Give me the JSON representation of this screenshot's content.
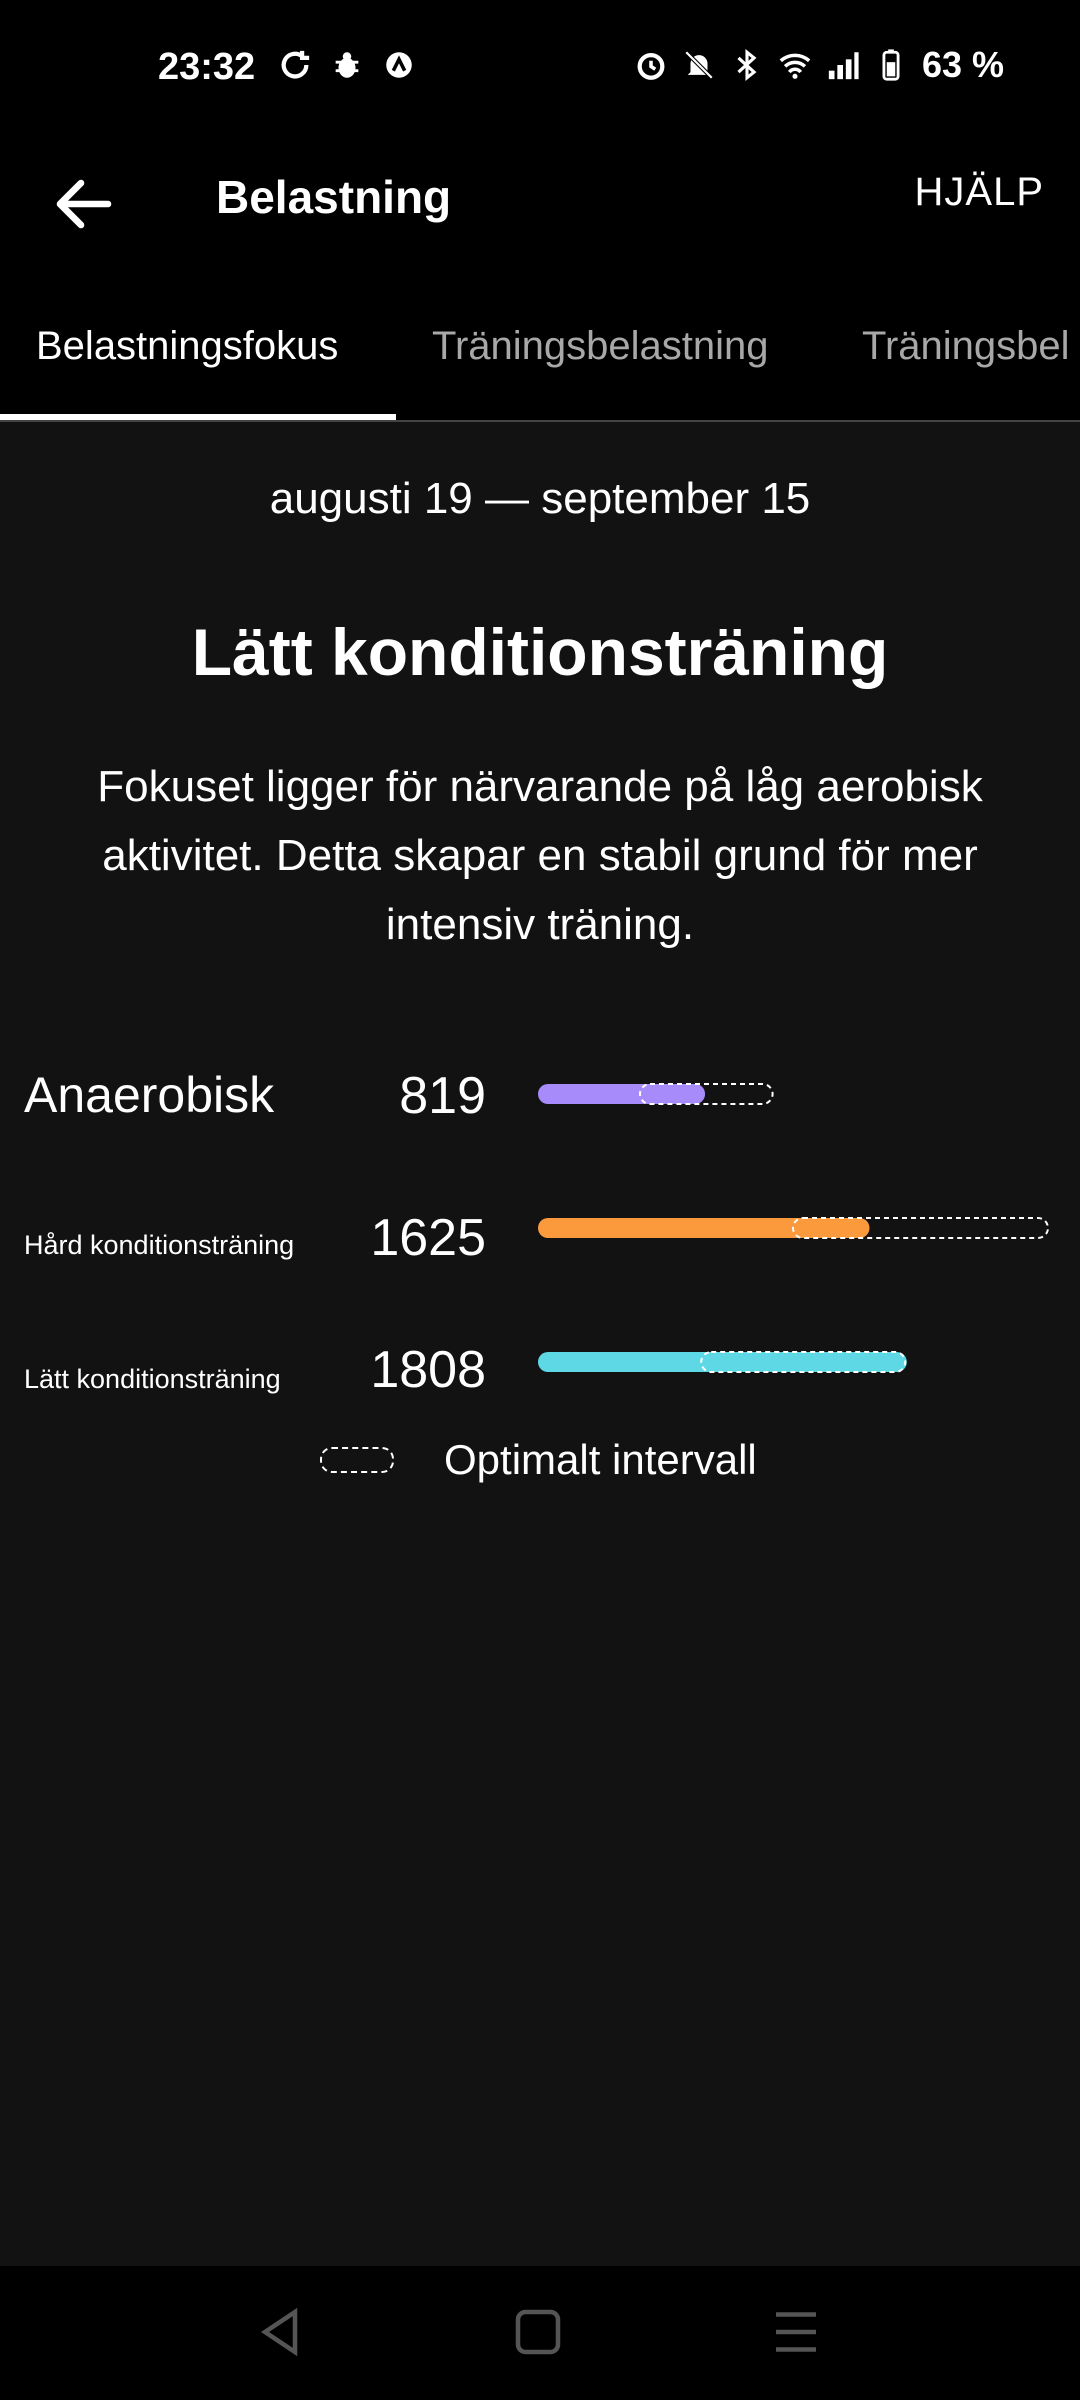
{
  "status_bar": {
    "time": "23:32",
    "battery": "63 %",
    "icons": [
      "sync-icon",
      "bug-icon",
      "vpn-icon",
      "alarm-icon",
      "mute-icon",
      "bluetooth-icon",
      "wifi-icon",
      "signal-icon",
      "battery-icon"
    ]
  },
  "app_bar": {
    "title": "Belastning",
    "help_label": "HJÄLP"
  },
  "tabs": [
    {
      "label": "Belastningsfokus",
      "selected": true
    },
    {
      "label": "Träningsbelastning",
      "selected": false
    },
    {
      "label": "Träningsbel",
      "selected": false
    }
  ],
  "date_range": "augusti 19 — september 15",
  "focus": {
    "title": "Lätt konditionsträning",
    "description": "Fokuset ligger för närvarande på låg aerobisk aktivitet. Detta skapar en stabil grund för mer intensiv träning."
  },
  "chart_data": {
    "type": "bar",
    "scale_max": 2500,
    "series": [
      {
        "name": "Anaerobisk",
        "value": 819,
        "color": "#a78bfa",
        "optimal_range": [
          500,
          1150
        ]
      },
      {
        "name": "Hård konditionsträning",
        "value": 1625,
        "color": "#fb9a3c",
        "optimal_range": [
          1250,
          2500
        ]
      },
      {
        "name": "Lätt konditionsträning",
        "value": 1808,
        "color": "#5fd8e6",
        "optimal_range": [
          800,
          1800
        ]
      }
    ]
  },
  "legend": {
    "label": "Optimalt intervall"
  }
}
